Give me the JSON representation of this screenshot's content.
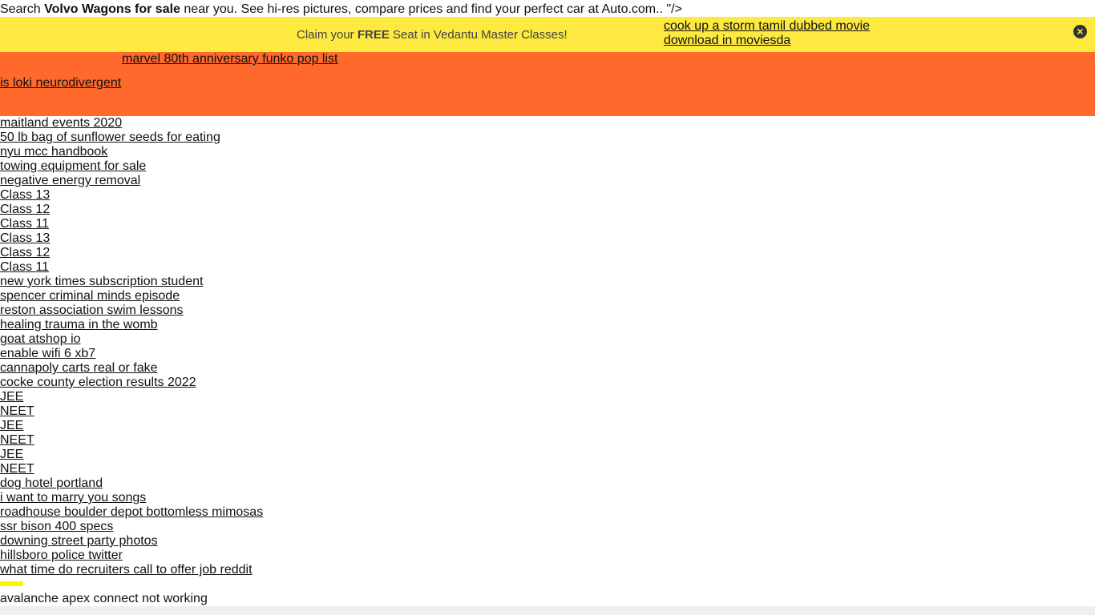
{
  "top": {
    "pre": "Search ",
    "bold": "Volvo Wagons for sale",
    "post": " near you. See hi-res pictures, compare prices and find your perfect car at Auto.com.. \"/>"
  },
  "banner": {
    "claim_pre": "Claim your ",
    "claim_bold": "FREE",
    "claim_post": " Seat in Vedantu Master Classes!",
    "link1": "cook up a storm tamil dubbed movie",
    "link2": "download in moviesda",
    "close_icon": "×"
  },
  "orange": {
    "link1": "marvel 80th anniversary funko pop list",
    "link2": "is loki neurodivergent"
  },
  "links": [
    "maitland events 2020",
    "50 lb bag of sunflower seeds for eating",
    "nyu mcc handbook",
    "towing equipment for sale",
    "negative energy removal",
    "Class 13",
    "Class 12",
    "Class 11",
    "Class 13",
    "Class 12",
    "Class 11",
    "new york times subscription student",
    "spencer criminal minds episode",
    "reston association swim lessons",
    "healing trauma in the womb",
    "goat atshop io",
    "enable wifi 6 xb7",
    "cannapoly carts real or fake",
    "cocke county election results 2022",
    "JEE",
    "NEET",
    "JEE",
    "NEET",
    "JEE",
    "NEET",
    "dog hotel portland",
    "i want to marry you songs",
    "roadhouse boulder depot bottomless mimosas",
    "ssr bison 400 specs",
    "downing street party photos",
    "hillsboro police twitter",
    "what time do recruiters call to offer job reddit"
  ],
  "last": "avalanche apex connect not working",
  "colors": {
    "yellow": "#fde93f",
    "orange": "#ff6a2c"
  }
}
